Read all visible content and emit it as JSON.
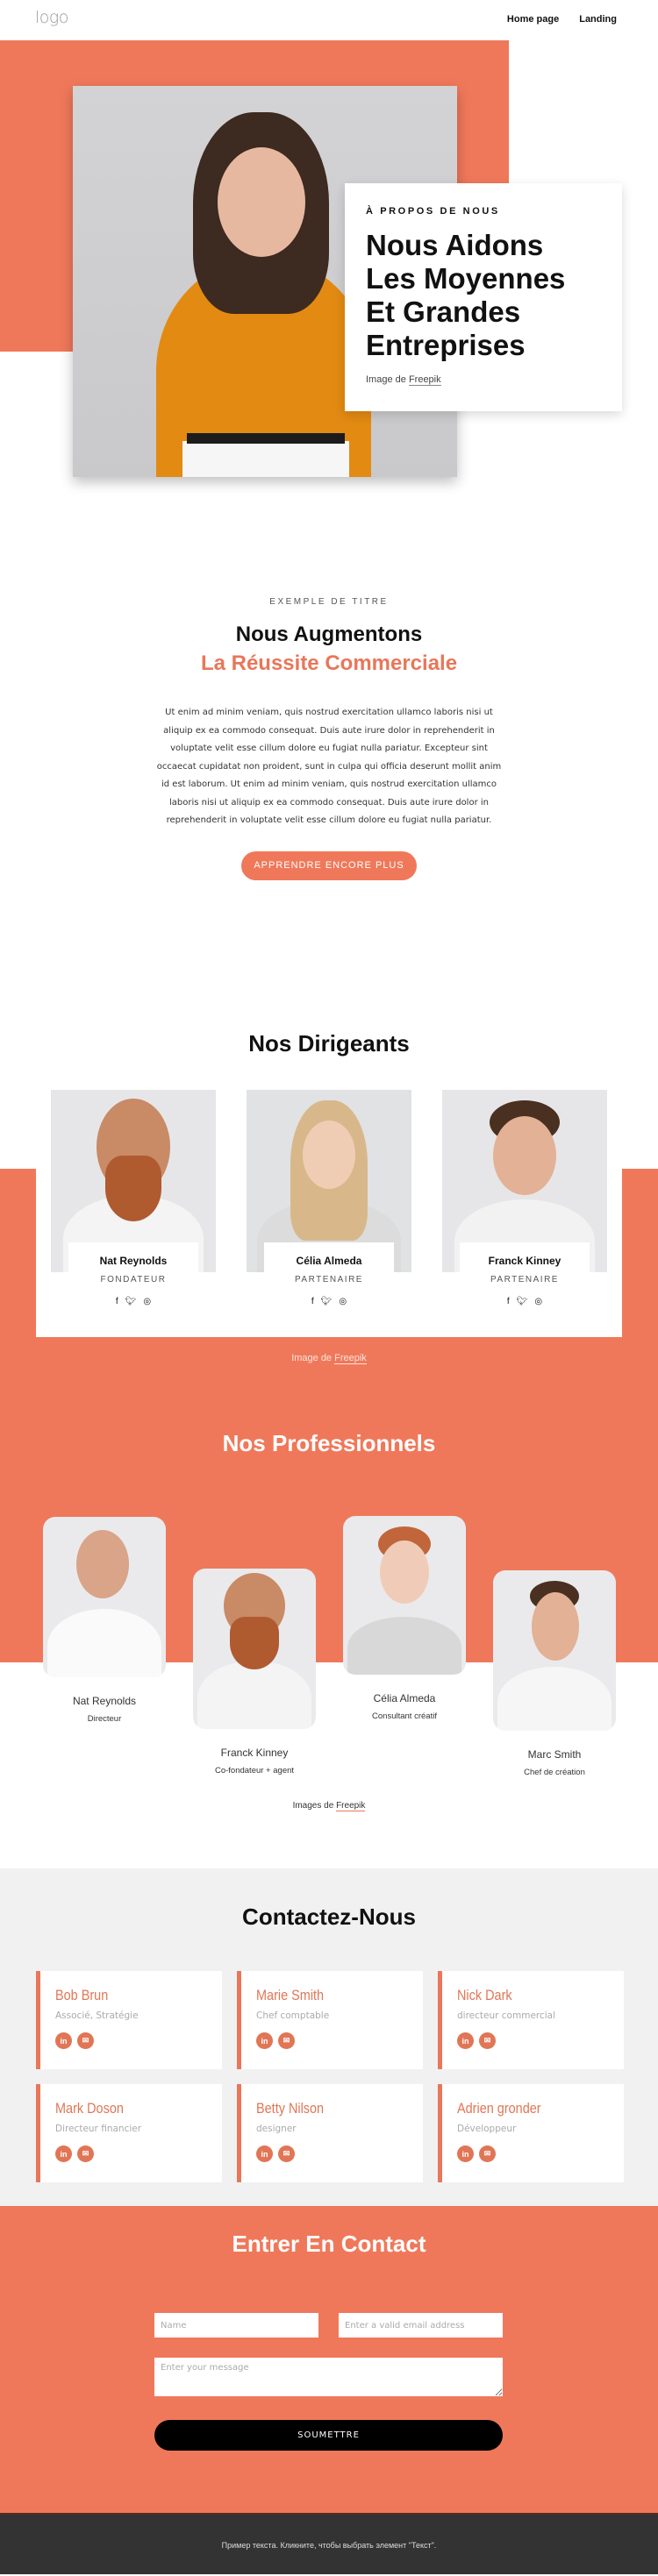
{
  "header": {
    "logo": "logo",
    "nav": [
      "Home page",
      "Landing"
    ]
  },
  "hero": {
    "eyebrow": "À PROPOS DE NOUS",
    "title": "Nous Aidons Les Moyennes Et Grandes Entreprises",
    "credit_prefix": "Image de",
    "credit_link": "Freepik"
  },
  "intro": {
    "eyebrow": "EXEMPLE DE TITRE",
    "title_line1": "Nous Augmentons",
    "title_line2": "La Réussite Commerciale",
    "paragraph": "Ut enim ad minim veniam, quis nostrud exercitation ullamco laboris nisi ut aliquip ex ea commodo consequat. Duis aute irure dolor in reprehenderit in voluptate velit esse cillum dolore eu fugiat nulla pariatur. Excepteur sint occaecat cupidatat non proident, sunt in culpa qui officia deserunt mollit anim id est laborum. Ut enim ad minim veniam, quis nostrud exercitation ullamco laboris nisi ut aliquip ex ea commodo consequat. Duis aute irure dolor in reprehenderit in voluptate velit esse cillum dolore eu fugiat nulla pariatur.",
    "button": "APPRENDRE ENCORE PLUS"
  },
  "leaders": {
    "title": "Nos Dirigeants",
    "people": [
      {
        "name": "Nat Reynolds",
        "role": "FONDATEUR"
      },
      {
        "name": "Célia Almeda",
        "role": "PARTENAIRE"
      },
      {
        "name": "Franck Kinney",
        "role": "PARTENAIRE"
      }
    ],
    "social_icons": [
      "facebook-icon",
      "twitter-icon",
      "instagram-icon"
    ],
    "credit_prefix": "Image de",
    "credit_link": "Freepik"
  },
  "professionals": {
    "title": "Nos Professionnels",
    "people": [
      {
        "name": "Nat Reynolds",
        "role": "Directeur"
      },
      {
        "name": "Franck Kinney",
        "role": "Co-fondateur + agent"
      },
      {
        "name": "Célia Almeda",
        "role": "Consultant créatif"
      },
      {
        "name": "Marc Smith",
        "role": "Chef de création"
      }
    ],
    "credit_prefix": "Images de",
    "credit_link": "Freepik"
  },
  "contacts": {
    "title": "Contactez-Nous",
    "cards": [
      {
        "name": "Bob Brun",
        "role": "Associé, Stratégie"
      },
      {
        "name": "Marie Smith",
        "role": "Chef comptable"
      },
      {
        "name": "Nick Dark",
        "role": "directeur commercial"
      },
      {
        "name": "Mark Doson",
        "role": "Directeur financier"
      },
      {
        "name": "Betty Nilson",
        "role": "designer"
      },
      {
        "name": "Adrien gronder",
        "role": "Développeur"
      }
    ]
  },
  "form": {
    "title": "Entrer En Contact",
    "name_placeholder": "Name",
    "email_placeholder": "Enter a valid email address",
    "message_placeholder": "Enter your message",
    "submit": "SOUMETTRE"
  },
  "footer": {
    "text": "Пример текста. Кликните, чтобы выбрать элемент \"Текст\"."
  },
  "colors": {
    "accent": "#f0785a",
    "accent_text": "#e07656",
    "footer_bg": "#333333",
    "contacts_bg": "#f1f1f1"
  }
}
